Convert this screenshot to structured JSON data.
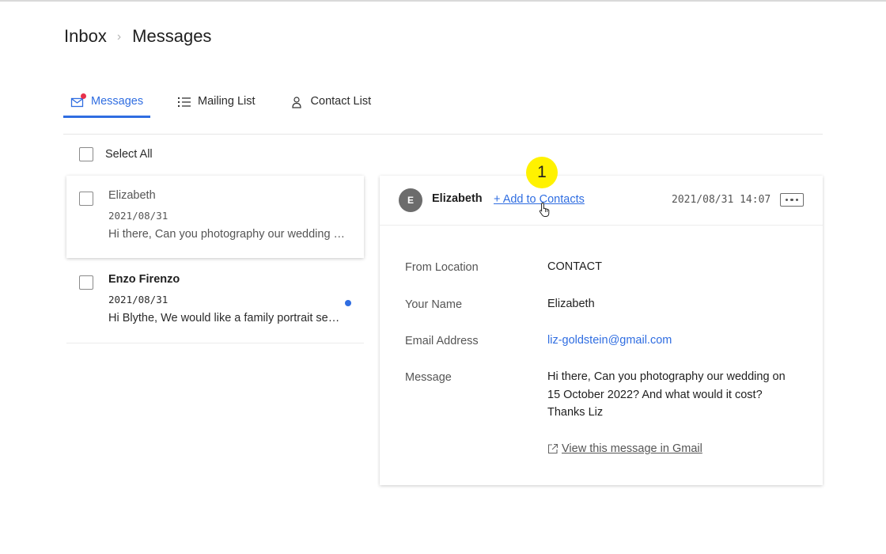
{
  "breadcrumb": {
    "root": "Inbox",
    "current": "Messages"
  },
  "tabs": [
    {
      "label": "Messages",
      "icon": "envelope-icon",
      "active": true
    },
    {
      "label": "Mailing List",
      "icon": "list-icon",
      "active": false
    },
    {
      "label": "Contact List",
      "icon": "person-icon",
      "active": false
    }
  ],
  "select_all_label": "Select All",
  "messages": [
    {
      "sender": "Elizabeth",
      "date": "2021/08/31",
      "preview": "Hi there, Can you photography our wedding on 15 October 2022? And what would it cost? Thanks Liz",
      "selected": true,
      "unread": false
    },
    {
      "sender": "Enzo Firenzo",
      "date": "2021/08/31",
      "preview": "Hi Blythe,  We would like a family portrait session",
      "selected": false,
      "unread": true
    }
  ],
  "detail": {
    "avatar_initial": "E",
    "from_name": "Elizabeth",
    "add_contacts_label": "+ Add to Contacts",
    "timestamp": "2021/08/31 14:07",
    "fields": [
      {
        "label": "From Location",
        "value": "CONTACT"
      },
      {
        "label": "Your Name",
        "value": "Elizabeth"
      },
      {
        "label": "Email Address",
        "value": "liz-goldstein@gmail.com"
      },
      {
        "label": "Message",
        "value": "Hi there, Can you photography our wedding on 15 October 2022? And what would it cost? Thanks Liz"
      }
    ],
    "gmail_link_label": "View this message in Gmail"
  },
  "annotation": {
    "step": "1"
  },
  "colors": {
    "accent": "#2f6de1",
    "unread_badge": "#e8314b",
    "annotation": "#fff200"
  }
}
